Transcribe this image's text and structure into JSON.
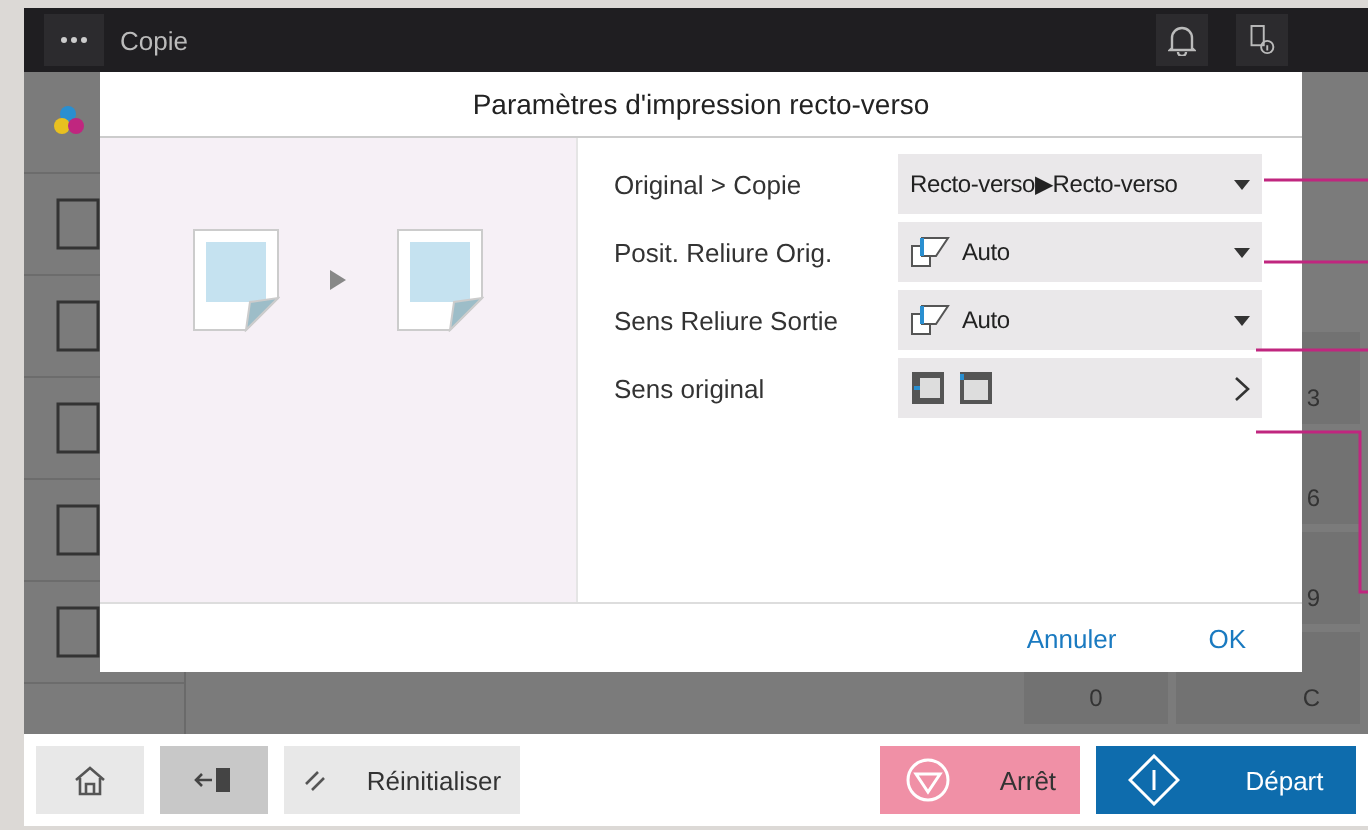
{
  "top_bar": {
    "title": "Copie"
  },
  "keypad": [
    "3",
    "6",
    "9",
    "0",
    "C"
  ],
  "dialog": {
    "title": "Paramètres d'impression recto-verso",
    "settings": [
      {
        "label": "Original > Copie",
        "kind": "dropdown",
        "value": "Recto-verso▶Recto-verso"
      },
      {
        "label": "Posit. Reliure Orig.",
        "kind": "binding_dropdown",
        "value": "Auto"
      },
      {
        "label": "Sens Reliure Sortie",
        "kind": "binding_dropdown",
        "value": "Auto"
      },
      {
        "label": "Sens original",
        "kind": "nav"
      }
    ],
    "buttons": [
      "Annuler",
      "OK"
    ]
  },
  "bottom_bar": [
    {
      "kind": "home"
    },
    {
      "kind": "logout"
    },
    {
      "kind": "reset",
      "label": "Réinitialiser"
    },
    {
      "kind": "stop",
      "label": "Arrêt"
    },
    {
      "kind": "start",
      "label": "Départ"
    }
  ]
}
